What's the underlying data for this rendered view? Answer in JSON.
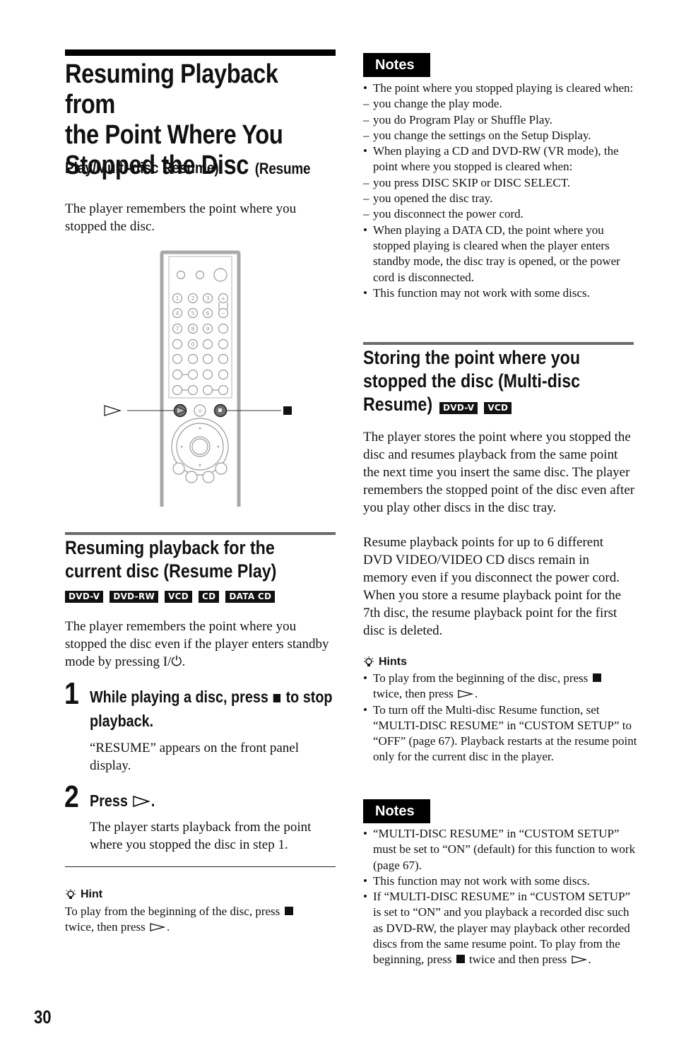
{
  "page": {
    "number": "30"
  },
  "left": {
    "title_line1": "Resuming Playback from",
    "title_line2": "the Point Where You",
    "title_line3": "Stopped the Disc",
    "title_suffix": "(Resume",
    "title_sub": "Play/Multi-disc Resume)",
    "intro": "The player remembers the point where you stopped the disc.",
    "remote": {
      "play_callout": "play-symbol",
      "stop_callout": "stop-symbol"
    },
    "section": {
      "title_line1": "Resuming playback for the",
      "title_line2": "current disc (Resume Play)",
      "badges": [
        "DVD-V",
        "DVD-RW",
        "VCD",
        "CD",
        "DATA CD"
      ],
      "body": "The player remembers the point where you stopped the disc even if the player enters standby mode by pressing",
      "body_symbol": "I/⏻",
      "body_end": ".",
      "steps": [
        {
          "number": "1",
          "title_before": "While playing a disc, press",
          "title_after": "to stop playback.",
          "body": "“RESUME” appears on the front panel display."
        },
        {
          "number": "2",
          "title_before": "Press",
          "title_after": ".",
          "body": "The player starts playback from the point where you stopped the disc in step 1."
        }
      ]
    },
    "hint": {
      "label": "Hint",
      "text_before": "To play from the beginning of the disc, press",
      "text_middle": "twice, then press",
      "text_end": "."
    }
  },
  "right": {
    "notes1": {
      "label": "Notes",
      "items": [
        {
          "type": "bullet",
          "text": "The point where you stopped playing is cleared when:"
        },
        {
          "type": "dash",
          "text": "you change the play mode."
        },
        {
          "type": "dash",
          "text": "you do Program Play or Shuffle Play."
        },
        {
          "type": "dash",
          "text": "you change the settings on the Setup Display."
        },
        {
          "type": "bullet",
          "text": "When playing a CD and DVD-RW (VR mode), the point where you stopped is cleared when:"
        },
        {
          "type": "dash",
          "text": "you press DISC SKIP or DISC SELECT."
        },
        {
          "type": "dash",
          "text": "you opened the disc tray."
        },
        {
          "type": "dash",
          "text": "you disconnect the power cord."
        },
        {
          "type": "bullet",
          "text": "When playing a DATA CD, the point where you stopped playing is cleared when the player enters standby mode, the disc tray is opened, or the power cord is disconnected."
        },
        {
          "type": "bullet",
          "text": "This function may not work with some discs."
        }
      ]
    },
    "section": {
      "title_line1": "Storing the point where you",
      "title_line2": "stopped the disc (Multi-disc",
      "title_line3": "Resume)",
      "badges": [
        "DVD-V",
        "VCD"
      ],
      "body": "The player stores the point where you stopped the disc and resumes playback from the same point the next time you insert the same disc. The player remembers the stopped point of the disc even after you play other discs in the disc tray.",
      "body2": "Resume playback points for up to 6 different DVD VIDEO/VIDEO CD discs remain in memory even if you disconnect the power cord. When you store a resume playback point for the 7th disc, the resume playback point for the first disc is deleted."
    },
    "hints": {
      "label": "Hints",
      "item1_before": "To play from the beginning of the disc, press",
      "item1_middle": "twice, then press",
      "item1_end": ".",
      "item2": "To turn off the Multi-disc Resume function, set “MULTI-DISC RESUME” in “CUSTOM SETUP” to “OFF” (page 67). Playback restarts at the resume point only for the current disc in the player."
    },
    "notes2": {
      "label": "Notes",
      "item1": "“MULTI-DISC RESUME” in “CUSTOM SETUP” must be set to “ON” (default) for this function to work (page 67).",
      "item2": "This function may not work with some discs.",
      "item3_before": "If “MULTI-DISC RESUME” in “CUSTOM SETUP” is set to “ON” and you playback a recorded disc such as DVD-RW, the player may playback other recorded discs from the same resume point. To play from the beginning, press",
      "item3_middle": "twice and then press",
      "item3_end": "."
    }
  }
}
